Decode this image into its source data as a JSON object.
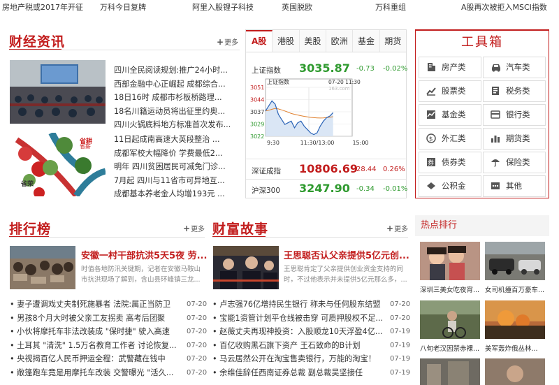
{
  "ticker": [
    "房地产税或2017年开征",
    "万科今日复牌",
    "阿里入股锂子科技",
    "英国脱欧",
    "万科重组",
    "A股再次被拒入MSCI指数"
  ],
  "finance": {
    "title": "财经资讯",
    "more": "更多",
    "list1": [
      "四川全民阅读规划:推广24小时...",
      "西部金融中心正崛起 成都综合...",
      "18日16时 成都市杉板桥路理...",
      "18名川籍运动员将出征里约奥...",
      "四川火锅底料地方标准首次发布..."
    ],
    "list2": [
      "11日起成南高速大英段整治 ...",
      "成都军校大幅降价 学费最低2...",
      "明年 四川贫困居民可减免门诊...",
      "7月起 四川与11省市可异地互...",
      "成都基本养老金人均增193元 ..."
    ],
    "label_a": "省耕",
    "label_b": "省薪",
    "label_c": "省荣"
  },
  "market": {
    "tabs": [
      "A股",
      "港股",
      "美股",
      "欧洲",
      "基金",
      "期货"
    ],
    "indices": [
      {
        "name": "上证指数",
        "value": "3035.87",
        "change": "-0.73",
        "pct": "-0.02%",
        "dir": "down"
      },
      {
        "name": "深证成指",
        "value": "10806.69",
        "change": "28.44",
        "pct": "0.26%",
        "dir": "up"
      },
      {
        "name": "沪深300",
        "value": "3247.90",
        "change": "-0.34",
        "pct": "-0.01%",
        "dir": "down"
      }
    ],
    "chart_data": {
      "type": "line",
      "title": "上证指数",
      "time": "07-20 11:30",
      "watermark": "163.com",
      "y_ticks": [
        "3051",
        "3044",
        "3037",
        "3029",
        "3022"
      ],
      "x_ticks": [
        "9:30",
        "11:30/13:00",
        "15:00"
      ],
      "ylim": [
        3022,
        3051
      ],
      "series": [
        {
          "name": "price",
          "color": "#2a63b7",
          "values": [
            3037,
            3040,
            3043,
            3041,
            3035,
            3032,
            3029,
            3030,
            3031,
            3027,
            3030,
            3031,
            3028,
            3026,
            3024,
            3023,
            3024,
            3028,
            3031,
            3033,
            3034,
            3036
          ]
        },
        {
          "name": "avg",
          "color": "#e0802d",
          "values": [
            3037,
            3037.4,
            3038,
            3038.5,
            3038.2,
            3037.6,
            3037,
            3036.3,
            3035.5,
            3035,
            3034.6,
            3034.2,
            3033.8,
            3033.5,
            3033.2,
            3033,
            3032.9,
            3032.8,
            3032.9,
            3033.1,
            3033.3,
            3033.6
          ]
        }
      ]
    }
  },
  "toolbox": {
    "title": "工具箱",
    "items": [
      "房产类",
      "汽车类",
      "股票类",
      "税务类",
      "基金类",
      "银行类",
      "外汇类",
      "期货类",
      "债券类",
      "保险类",
      "公积金",
      "其他"
    ]
  },
  "ranking": {
    "title": "排行榜",
    "more": "更多",
    "headline": "安徽一村干部抗洪5天5夜 劳...",
    "summary": "时值各地防汛关键期，记者在安徽马鞍山市抗洪现场了解到，含山县环峰镇三龙...",
    "items": [
      {
        "t": "妻子遭调戏丈夫制死施暴者 法院:属正当防卫",
        "d": "07-20"
      },
      {
        "t": "男孩8个月大时被父亲工友拐卖 高考后团聚",
        "d": "07-20"
      },
      {
        "t": "小伙将摩托车非法改装成 \"保时捷\" 驶入高速",
        "d": "07-20"
      },
      {
        "t": "土耳其 \"清洗\" 1.5万名教育工作者 讨论恢复...",
        "d": "07-20"
      },
      {
        "t": "央视揭百亿人民币押运全程：武警藏在钱中",
        "d": "07-20"
      },
      {
        "t": "敞篷跑车竟是用摩托车改装 交警曝光 \"活久...",
        "d": "07-20"
      }
    ]
  },
  "wealth": {
    "title": "财富故事",
    "more": "更多",
    "headline": "王思聪否认父亲提供5亿元创...",
    "summary": "王思聪肯定了父亲提供创业资金支持的同时，不过他表示并未提供5亿元那么多，...",
    "items": [
      {
        "t": "卢志强76亿增持民生银行 称未与任何股东结盟",
        "d": "07-20"
      },
      {
        "t": "宝能1资管计划平仓线被击穿 可质押股权不足...",
        "d": "07-20"
      },
      {
        "t": "赵薇丈夫再现神投资：入股顺龙10天浮盈4亿...",
        "d": "07-19"
      },
      {
        "t": "百亿收购黑石旗下资产 王石致命的B计划",
        "d": "07-19"
      },
      {
        "t": "马云居然公开在淘宝售卖银行，万能的淘宝！",
        "d": "07-19"
      },
      {
        "t": "余维佳辞任西南证券总裁 副总裁吴坚接任",
        "d": "07-19"
      }
    ]
  },
  "hot": {
    "title": "热点排行",
    "items": [
      "深圳三美女吃夜宵...",
      "女司机撞百万豪车...",
      "八旬老汉因禁赤裸...",
      "美军轰炸俄丛林..."
    ]
  }
}
